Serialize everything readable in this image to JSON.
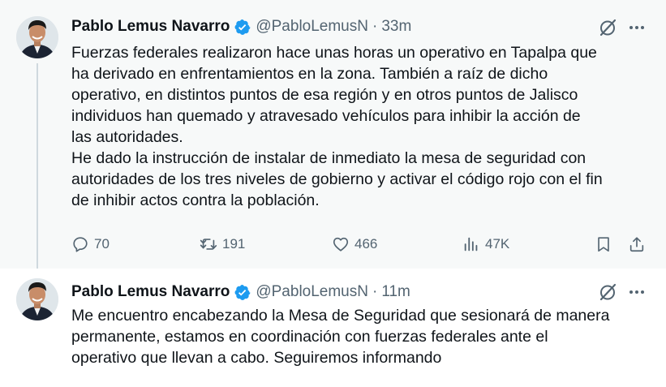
{
  "tweets": [
    {
      "author_name": "Pablo Lemus Navarro",
      "handle": "@PabloLemusN",
      "separator": "·",
      "time": "33m",
      "text_lines": [
        "Fuerzas federales realizaron hace unas horas un operativo en Tapalpa que",
        "ha derivado en enfrentamientos en la zona. También a raíz de dicho",
        "operativo, en distintos puntos de esa región y en otros puntos de Jalisco",
        "individuos han quemado y atravesado vehículos para inhibir la acción de",
        "las autoridades.",
        "He dado la instrucción de instalar de inmediato la mesa de seguridad con",
        "autoridades de los tres niveles de gobierno y activar el código rojo con el fin",
        "de inhibir actos contra la población."
      ],
      "replies": "70",
      "reposts": "191",
      "likes": "466",
      "views": "47K"
    },
    {
      "author_name": "Pablo Lemus Navarro",
      "handle": "@PabloLemusN",
      "separator": "·",
      "time": "11m",
      "text_lines": [
        "Me encuentro encabezando la Mesa de Seguridad que sesionará de manera",
        "permanente, estamos en coordinación con fuerzas federales ante el",
        "operativo que llevan a cabo. Seguiremos informando"
      ]
    }
  ],
  "colors": {
    "verified": "#1d9bf0",
    "secondary_text": "#536471",
    "thread_line": "#cfd9de",
    "first_tweet_bg": "#f7f9f9"
  },
  "icons": [
    "verified-badge-icon",
    "grok-icon",
    "more-icon",
    "reply-icon",
    "repost-icon",
    "like-icon",
    "views-icon",
    "bookmark-icon",
    "share-icon"
  ]
}
